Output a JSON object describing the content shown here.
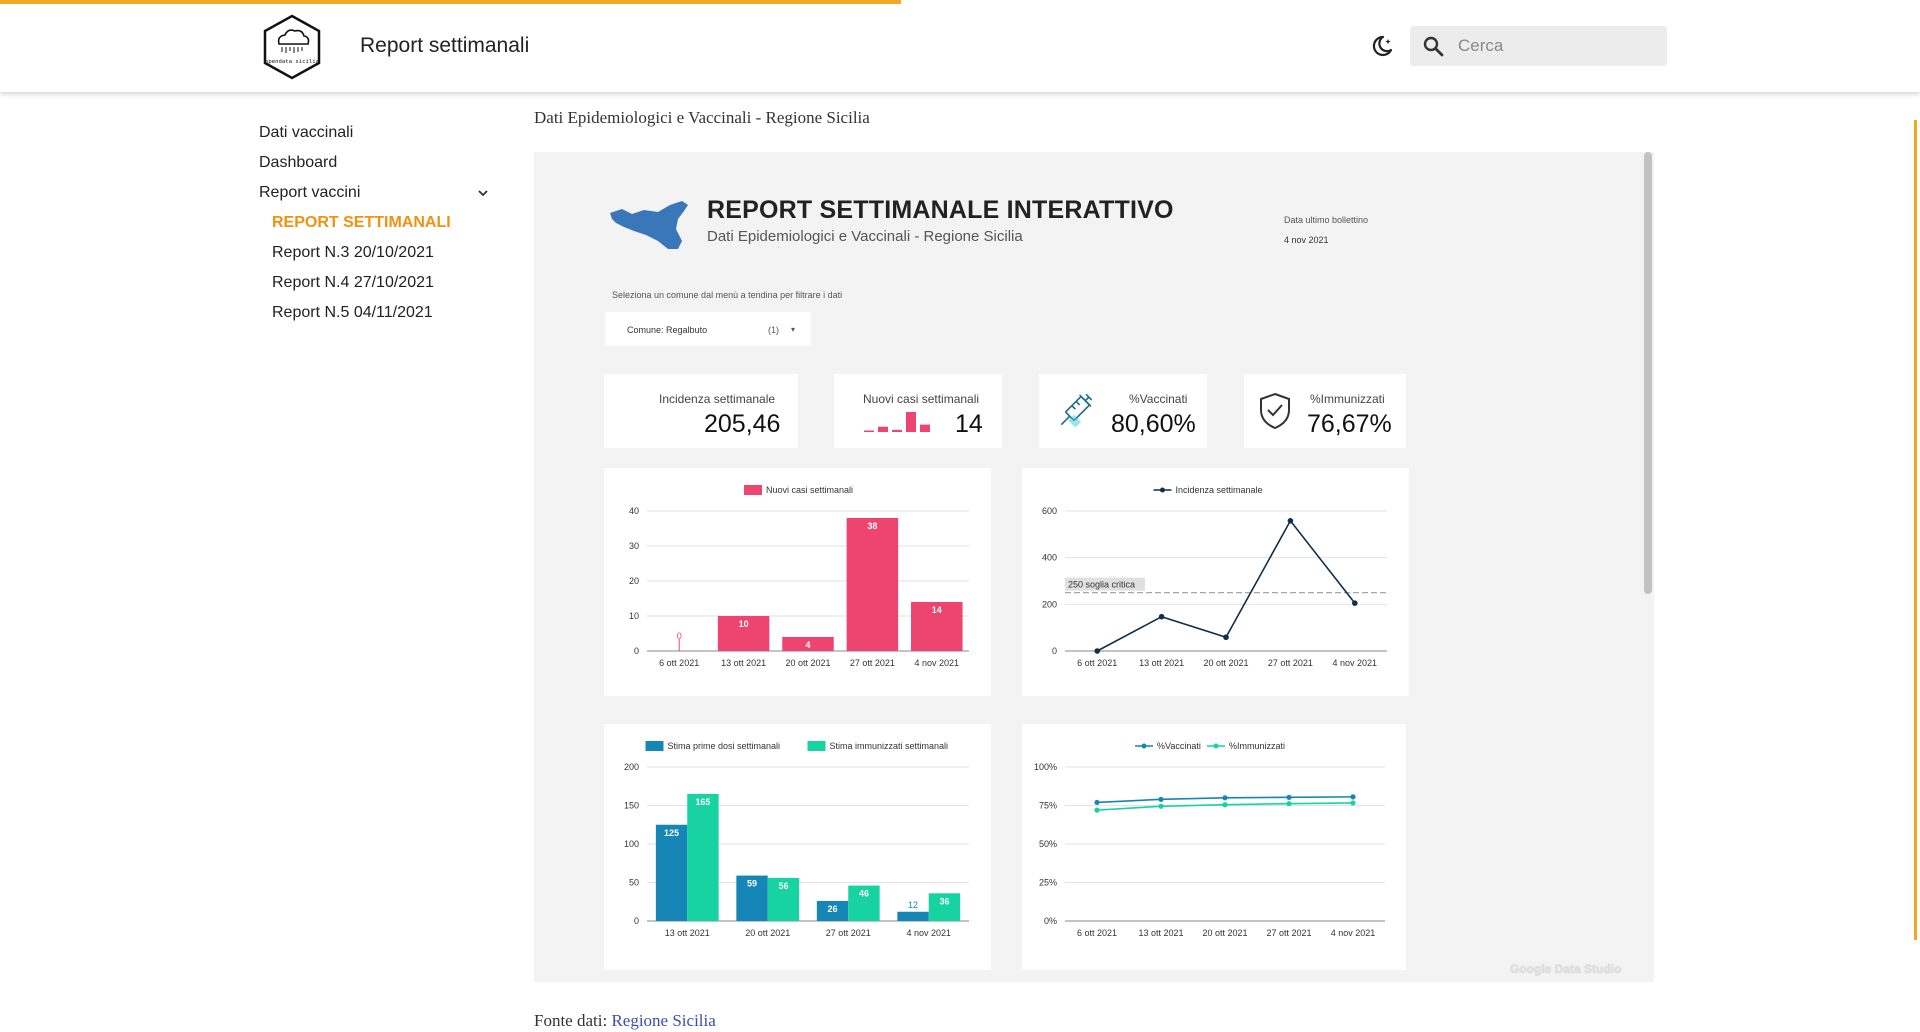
{
  "header": {
    "title": "Report settimanali",
    "search_placeholder": "Cerca",
    "logo_text": "opendata sicilia"
  },
  "sidebar": {
    "items": [
      {
        "label": "Dati vaccinali"
      },
      {
        "label": "Dashboard"
      },
      {
        "label": "Report vaccini"
      },
      {
        "label": "REPORT SETTIMANALI"
      },
      {
        "label": "Report N.3 20/10/2021"
      },
      {
        "label": "Report N.4 27/10/2021"
      },
      {
        "label": "Report N.5 04/11/2021"
      }
    ]
  },
  "breadcrumb": "Dati Epidemiologici e Vaccinali - Regione Sicilia",
  "report": {
    "title": "REPORT SETTIMANALE INTERATTIVO",
    "subtitle": "Dati Epidemiologici e Vaccinali - Regione Sicilia",
    "date_label": "Data ultimo bollettino",
    "date_value": "4 nov 2021",
    "filter_label": "Seleziona un comune dal menù a tendina per filtrare i dati",
    "filter_key": "Comune",
    "filter_value": "Regalbuto",
    "filter_count": "(1)",
    "watermark": "Google Data Studio"
  },
  "kpis": {
    "incidenza": {
      "label": "Incidenza settimanale",
      "value": "205,46"
    },
    "nuovi_casi": {
      "label": "Nuovi casi settimanali",
      "value": "14",
      "spark": [
        0,
        10,
        4,
        38,
        14
      ]
    },
    "vaccinati": {
      "label": "%Vaccinati",
      "value": "80,60%"
    },
    "immunizzati": {
      "label": "%Immunizzati",
      "value": "76,67%"
    }
  },
  "colors": {
    "accent": "#f29111",
    "pink": "#ee4570",
    "navy": "#0f2f4a",
    "blue": "#1586b5",
    "teal": "#17d3a2",
    "mapblue": "#3a77b8",
    "link": "#3b4db0"
  },
  "chart_data": [
    {
      "type": "bar",
      "categories": [
        "6 ott 2021",
        "13 ott 2021",
        "20 ott 2021",
        "27 ott 2021",
        "4 nov 2021"
      ],
      "series": [
        {
          "name": "Nuovi casi settimanali",
          "values": [
            0,
            10,
            4,
            38,
            14
          ]
        }
      ],
      "ylim": [
        0,
        40
      ],
      "yticks": [
        0,
        10,
        20,
        30,
        40
      ],
      "legend": "top"
    },
    {
      "type": "line",
      "categories": [
        "6 ott 2021",
        "13 ott 2021",
        "20 ott 2021",
        "27 ott 2021",
        "4 nov 2021"
      ],
      "series": [
        {
          "name": "Incidenza settimanale",
          "values": [
            0,
            147,
            59,
            558,
            205
          ]
        }
      ],
      "ylim": [
        0,
        600
      ],
      "yticks": [
        0,
        200,
        400,
        600
      ],
      "reference_line": {
        "value": 250,
        "label": "250 soglia critica"
      },
      "legend": "top"
    },
    {
      "type": "bar",
      "categories": [
        "13 ott 2021",
        "20 ott 2021",
        "27 ott 2021",
        "4 nov 2021"
      ],
      "series": [
        {
          "name": "Stima prime dosi settimanali",
          "values": [
            125,
            59,
            26,
            12
          ]
        },
        {
          "name": "Stima immunizzati settimanali",
          "values": [
            165,
            56,
            46,
            36
          ]
        }
      ],
      "ylim": [
        0,
        200
      ],
      "yticks": [
        0,
        50,
        100,
        150,
        200
      ],
      "legend": "top"
    },
    {
      "type": "line",
      "categories": [
        "6 ott 2021",
        "13 ott 2021",
        "20 ott 2021",
        "27 ott 2021",
        "4 nov 2021"
      ],
      "series": [
        {
          "name": "%Vaccinati",
          "values": [
            77,
            79,
            80,
            80.3,
            80.6
          ]
        },
        {
          "name": "%Immunizzati",
          "values": [
            72,
            74.5,
            75.5,
            76.2,
            76.67
          ]
        }
      ],
      "ylim": [
        0,
        100
      ],
      "yticks": [
        "0%",
        "25%",
        "50%",
        "75%",
        "100%"
      ],
      "legend": "top"
    }
  ],
  "footer": {
    "source_label": "Fonte dati:",
    "source_link": "Regione Sicilia"
  }
}
